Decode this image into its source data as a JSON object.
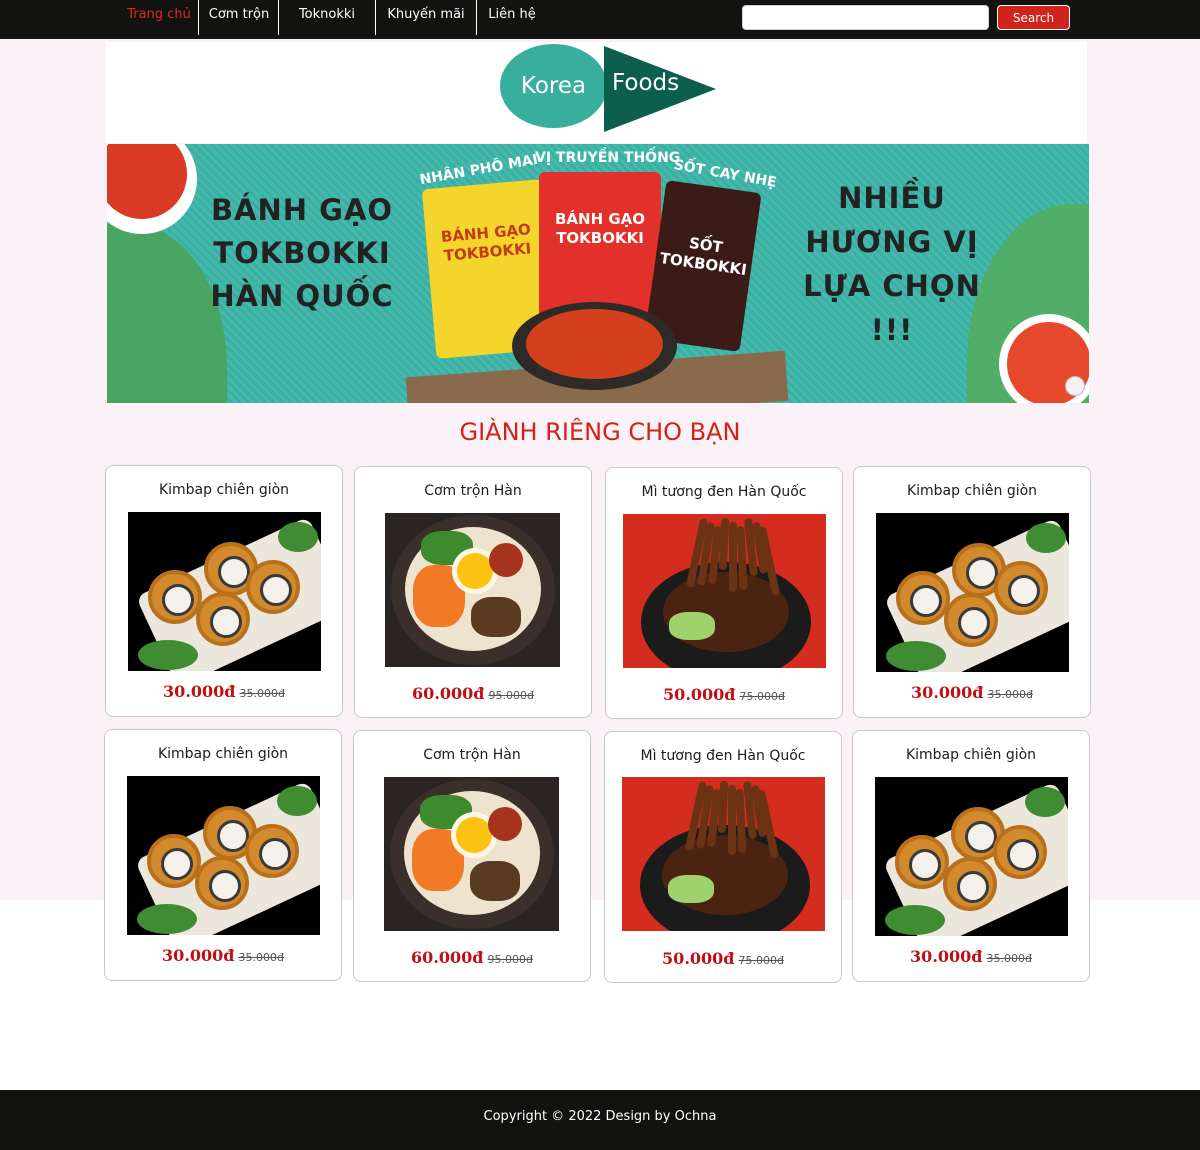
{
  "nav": {
    "items": [
      {
        "label": "Trang chủ",
        "active": true
      },
      {
        "label": "Cơm trộn",
        "active": false
      },
      {
        "label": "Toknokki",
        "active": false
      },
      {
        "label": "Khuyến mãi",
        "active": false
      },
      {
        "label": "Liên hệ",
        "active": false
      }
    ],
    "search_placeholder": "",
    "search_button": "Search"
  },
  "logo": {
    "word1": "Korea",
    "word2": "Foods",
    "colors": {
      "circle": "#38ae9d",
      "triangle": "#0d5f4d"
    }
  },
  "banner": {
    "left_text": "BÁNH GẠO TOKBOKKI HÀN QUỐC",
    "right_text": "NHIỀU HƯƠNG VỊ LỰA CHỌN !!!",
    "tags": [
      "NHÂN PHÔ MAI",
      "VỊ TRUYỀN THỐNG",
      "SỐT CAY NHẸ"
    ],
    "packs": [
      "BÁNH GẠO TOKBOKKI",
      "BÁNH GẠO TOKBOKKI",
      "SỐT TOKBOKKI"
    ]
  },
  "section": {
    "title": "GIÀNH RIÊNG CHO BẠN"
  },
  "products": [
    {
      "name": "Kimbap chiên giòn",
      "price": "30.000đ",
      "old_price": "35.000đ",
      "image": "kimbap"
    },
    {
      "name": "Cơm trộn Hàn",
      "price": "60.000đ",
      "old_price": "95.000đ",
      "image": "bibimbap"
    },
    {
      "name": "Mì tương đen Hàn Quốc",
      "price": "50.000đ",
      "old_price": "75.000đ",
      "image": "jjajangmyeon"
    },
    {
      "name": "Kimbap chiên giòn",
      "price": "30.000đ",
      "old_price": "35.000đ",
      "image": "kimbap"
    },
    {
      "name": "Kimbap chiên giòn",
      "price": "30.000đ",
      "old_price": "35.000đ",
      "image": "kimbap"
    },
    {
      "name": "Cơm trộn Hàn",
      "price": "60.000đ",
      "old_price": "95.000đ",
      "image": "bibimbap"
    },
    {
      "name": "Mì tương đen Hàn Quốc",
      "price": "50.000đ",
      "old_price": "75.000đ",
      "image": "jjajangmyeon"
    },
    {
      "name": "Kimbap chiên giòn",
      "price": "30.000đ",
      "old_price": "35.000đ",
      "image": "kimbap"
    }
  ],
  "footer": {
    "text": "Copyright © 2022 Design by Ochna"
  },
  "colors": {
    "accent": "#d0231b",
    "price": "#c01016",
    "bar": "#121210",
    "band": "#fbf2f8"
  }
}
